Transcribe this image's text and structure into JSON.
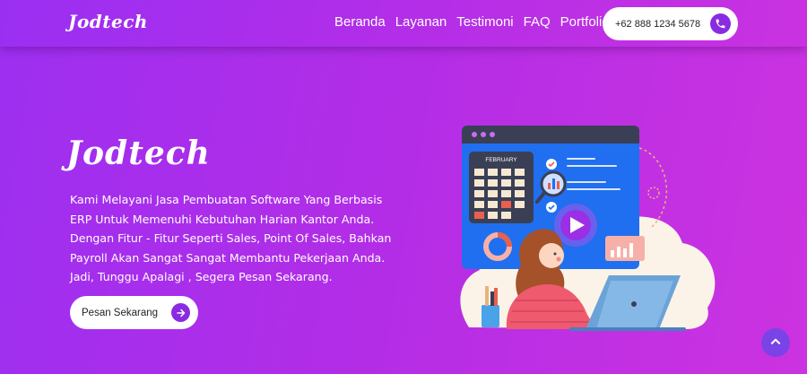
{
  "navbar": {
    "brand": "Jodtech",
    "links": [
      "Beranda",
      "Layanan",
      "Testimoni",
      "FAQ",
      "Portfolio"
    ],
    "phone": "+62 888 1234 5678"
  },
  "hero": {
    "title": "Jodtech",
    "lines": [
      "Kami Melayani Jasa Pembuatan Software Yang Berbasis",
      "ERP Untuk Memenuhi Kebutuhan Harian Kantor Anda.",
      "Dengan Fitur - Fitur Seperti Sales, Point Of Sales, Bahkan",
      "Payroll Akan Sangat Sangat Membantu Pekerjaan Anda.",
      "Jadi, Tunggu Apalagi , Segera Pesan Sekarang."
    ],
    "button_label": "Pesan Sekarang"
  },
  "illustration": {
    "calendar_month": "FEBRUARY"
  },
  "colors": {
    "accent": "#8a2be2",
    "background_start": "#9d2ff0",
    "background_end": "#cc33e0",
    "browser_blue": "#1f6ff0"
  },
  "icons": [
    "phone-icon",
    "arrow-right-icon",
    "play-icon",
    "chevron-up-icon"
  ]
}
